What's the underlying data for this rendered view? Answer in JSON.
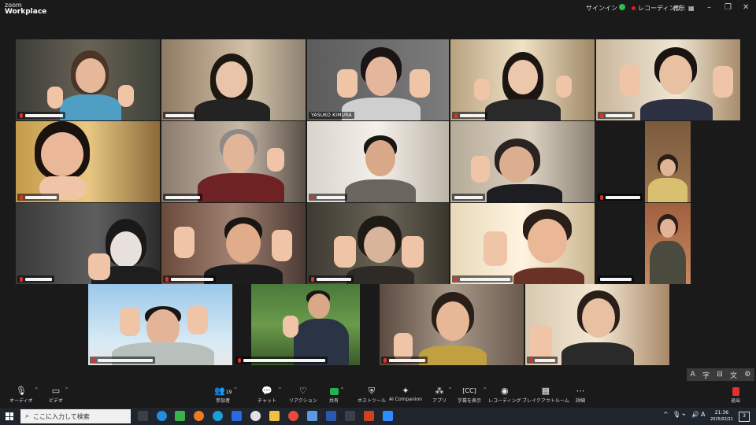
{
  "app": {
    "logo_line1": "zoom",
    "logo_line2": "Workplace"
  },
  "titlebar": {
    "signin": "サインイン",
    "recording": "レコーディング",
    "view": "表示",
    "minimize": "–",
    "restore": "❐",
    "close": "✕"
  },
  "participants": [
    {
      "name": ""
    },
    {
      "name": ""
    },
    {
      "name": "YASUKO KIMURA"
    },
    {
      "name": ""
    },
    {
      "name": ""
    },
    {
      "name": ""
    },
    {
      "name": ""
    },
    {
      "name": ""
    },
    {
      "name": ""
    },
    {
      "name": ""
    },
    {
      "name": ""
    },
    {
      "name": ""
    },
    {
      "name": ""
    },
    {
      "name": ""
    },
    {
      "name": ""
    },
    {
      "name": ""
    },
    {
      "name": ""
    },
    {
      "name": ""
    },
    {
      "name": ""
    }
  ],
  "side_tools": {
    "a": "A",
    "b": "字",
    "c": "⊟",
    "d": "文",
    "e": "⚙"
  },
  "toolbar": {
    "audio": "オーディオ",
    "video": "ビデオ",
    "participants": "参加者",
    "participants_count": "19",
    "chat": "チャット",
    "reactions": "リアクション",
    "share": "共有",
    "host_tools": "ホストツール",
    "ai_companion": "AI Companion",
    "apps": "アプリ",
    "captions": "字幕を表示",
    "record": "レコーディング",
    "breakout": "ブレイクアウトルーム",
    "more": "詳細",
    "leave": "退出"
  },
  "taskbar": {
    "search_placeholder": "ここに入力して検索",
    "time": "21:36",
    "date": "2025/02/21",
    "ime": "A",
    "notifications": "3"
  },
  "colors": {
    "active_border": "#33c46a",
    "share_green": "#22b14c",
    "leave_red": "#e03030",
    "rec_red": "#e02020"
  }
}
